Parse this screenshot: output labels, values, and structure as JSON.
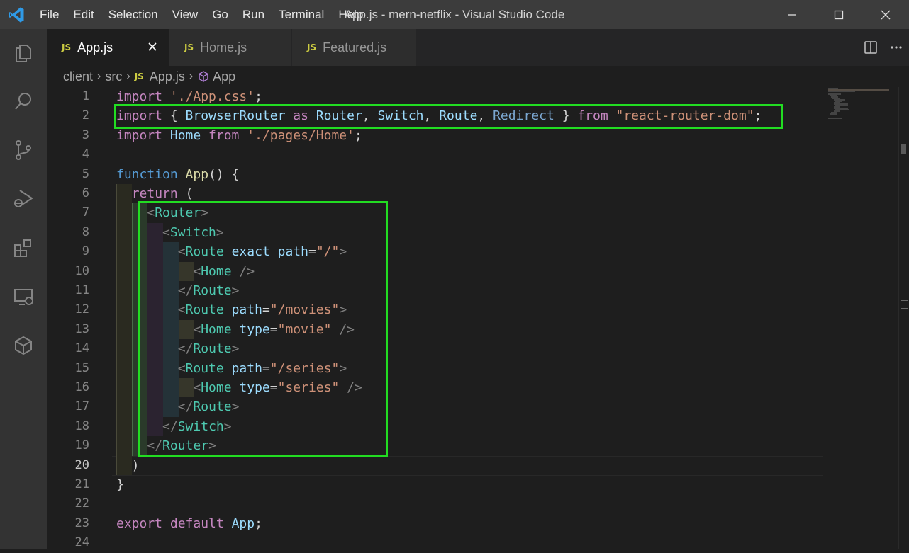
{
  "titlebar": {
    "menu": [
      "File",
      "Edit",
      "Selection",
      "View",
      "Go",
      "Run",
      "Terminal",
      "Help"
    ],
    "title": "App.js - mern-netflix - Visual Studio Code"
  },
  "tabs": [
    {
      "badge": "JS",
      "label": "App.js"
    },
    {
      "badge": "JS",
      "label": "Home.js"
    },
    {
      "badge": "JS",
      "label": "Featured.js"
    }
  ],
  "breadcrumb": {
    "parts": [
      "client",
      "src"
    ],
    "file_badge": "JS",
    "file": "App.js",
    "symbol": "App"
  },
  "editor": {
    "current_line": 20,
    "line_numbers": [
      "1",
      "2",
      "3",
      "4",
      "5",
      "6",
      "7",
      "8",
      "9",
      "10",
      "11",
      "12",
      "13",
      "14",
      "15",
      "16",
      "17",
      "18",
      "19",
      "20",
      "21",
      "22",
      "23",
      "24"
    ],
    "lines": [
      [
        [
          "kw-pink",
          "import "
        ],
        [
          "str",
          "'./App.css'"
        ],
        [
          "plain",
          ";"
        ]
      ],
      [
        [
          "kw-pink",
          "import "
        ],
        [
          "plain",
          "{ "
        ],
        [
          "var",
          "BrowserRouter "
        ],
        [
          "kw-pink",
          "as "
        ],
        [
          "var",
          "Router"
        ],
        [
          "plain",
          ", "
        ],
        [
          "var",
          "Switch"
        ],
        [
          "plain",
          ", "
        ],
        [
          "var",
          "Route"
        ],
        [
          "plain",
          ", "
        ],
        [
          "redirect",
          "Redirect"
        ],
        [
          "plain",
          " } "
        ],
        [
          "kw-pink",
          "from "
        ],
        [
          "str",
          "\"react-router-dom\""
        ],
        [
          "plain",
          ";"
        ]
      ],
      [
        [
          "kw-pink",
          "import "
        ],
        [
          "var",
          "Home "
        ],
        [
          "kw-pink",
          "from "
        ],
        [
          "str",
          "'./pages/Home'"
        ],
        [
          "plain",
          ";"
        ]
      ],
      [],
      [
        [
          "kw-blue",
          "function "
        ],
        [
          "fn",
          "App"
        ],
        [
          "plain",
          "() {"
        ]
      ],
      [
        [
          "plain",
          "  "
        ],
        [
          "kw-pink",
          "return "
        ],
        [
          "plain",
          "("
        ]
      ],
      [
        [
          "plain",
          "    "
        ],
        [
          "punct",
          "<"
        ],
        [
          "tag",
          "Router"
        ],
        [
          "punct",
          ">"
        ]
      ],
      [
        [
          "plain",
          "      "
        ],
        [
          "punct",
          "<"
        ],
        [
          "tag",
          "Switch"
        ],
        [
          "punct",
          ">"
        ]
      ],
      [
        [
          "plain",
          "        "
        ],
        [
          "punct",
          "<"
        ],
        [
          "tag",
          "Route "
        ],
        [
          "attr",
          "exact "
        ],
        [
          "attr",
          "path"
        ],
        [
          "plain",
          "="
        ],
        [
          "str",
          "\"/\""
        ],
        [
          "punct",
          ">"
        ]
      ],
      [
        [
          "plain",
          "          "
        ],
        [
          "punct",
          "<"
        ],
        [
          "tag",
          "Home "
        ],
        [
          "punct",
          "/>"
        ]
      ],
      [
        [
          "plain",
          "        "
        ],
        [
          "punct",
          "</"
        ],
        [
          "tag",
          "Route"
        ],
        [
          "punct",
          ">"
        ]
      ],
      [
        [
          "plain",
          "        "
        ],
        [
          "punct",
          "<"
        ],
        [
          "tag",
          "Route "
        ],
        [
          "attr",
          "path"
        ],
        [
          "plain",
          "="
        ],
        [
          "str",
          "\"/movies\""
        ],
        [
          "punct",
          ">"
        ]
      ],
      [
        [
          "plain",
          "          "
        ],
        [
          "punct",
          "<"
        ],
        [
          "tag",
          "Home "
        ],
        [
          "attr",
          "type"
        ],
        [
          "plain",
          "="
        ],
        [
          "str",
          "\"movie\" "
        ],
        [
          "punct",
          "/>"
        ]
      ],
      [
        [
          "plain",
          "        "
        ],
        [
          "punct",
          "</"
        ],
        [
          "tag",
          "Route"
        ],
        [
          "punct",
          ">"
        ]
      ],
      [
        [
          "plain",
          "        "
        ],
        [
          "punct",
          "<"
        ],
        [
          "tag",
          "Route "
        ],
        [
          "attr",
          "path"
        ],
        [
          "plain",
          "="
        ],
        [
          "str",
          "\"/series\""
        ],
        [
          "punct",
          ">"
        ]
      ],
      [
        [
          "plain",
          "          "
        ],
        [
          "punct",
          "<"
        ],
        [
          "tag",
          "Home "
        ],
        [
          "attr",
          "type"
        ],
        [
          "plain",
          "="
        ],
        [
          "str",
          "\"series\" "
        ],
        [
          "punct",
          "/>"
        ]
      ],
      [
        [
          "plain",
          "        "
        ],
        [
          "punct",
          "</"
        ],
        [
          "tag",
          "Route"
        ],
        [
          "punct",
          ">"
        ]
      ],
      [
        [
          "plain",
          "      "
        ],
        [
          "punct",
          "</"
        ],
        [
          "tag",
          "Switch"
        ],
        [
          "punct",
          ">"
        ]
      ],
      [
        [
          "plain",
          "    "
        ],
        [
          "punct",
          "</"
        ],
        [
          "tag",
          "Router"
        ],
        [
          "punct",
          ">"
        ]
      ],
      [
        [
          "plain",
          "  )"
        ]
      ],
      [
        [
          "plain",
          "}"
        ]
      ],
      [],
      [
        [
          "kw-pink",
          "export "
        ],
        [
          "kw-pink",
          "default "
        ],
        [
          "var",
          "App"
        ],
        [
          "plain",
          ";"
        ]
      ],
      []
    ]
  },
  "colors": {
    "annotation_box": "#22dd22",
    "accent": "#007acc"
  }
}
